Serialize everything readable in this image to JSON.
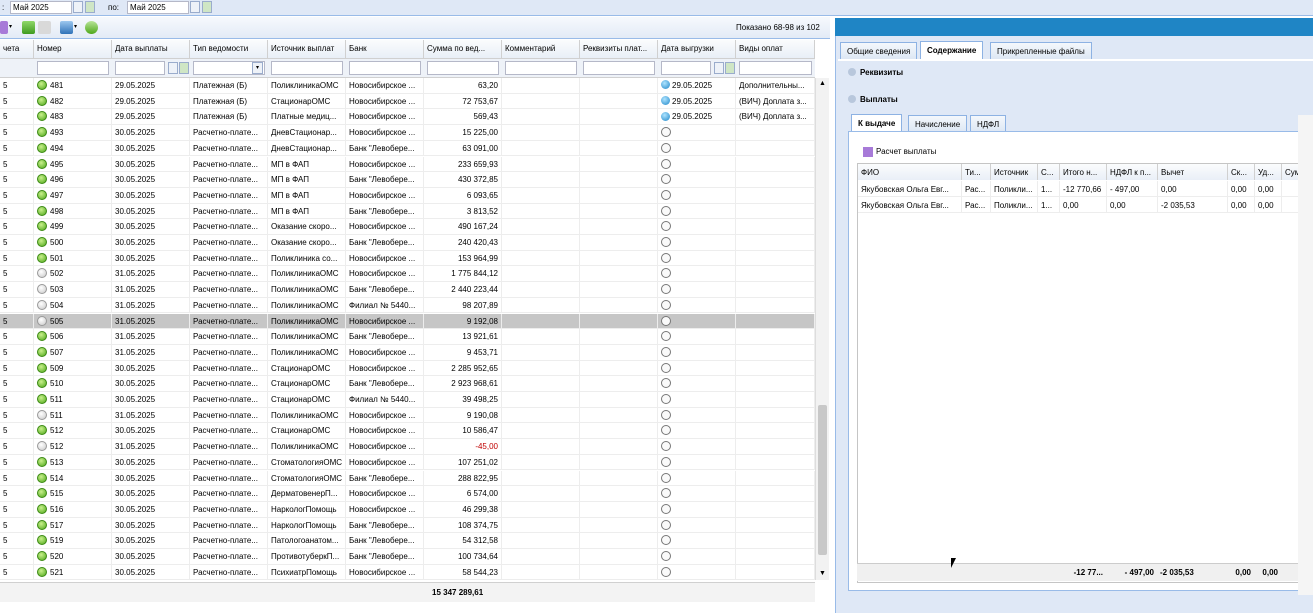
{
  "filter": {
    "from_prefix": ":",
    "from_value": "Май 2025",
    "to_label": "по:",
    "to_value": "Май 2025"
  },
  "grid": {
    "shown_label": "Показано 68-98 из 102",
    "columns": [
      "чета",
      "Номер",
      "Дата выплаты",
      "Тип ведомости",
      "Источник выплат",
      "Банк",
      "Сумма по вед...",
      "Комментарий",
      "Реквизиты плат...",
      "Дата выгрузки",
      "Виды оплат"
    ],
    "rows": [
      {
        "c0": "5",
        "num": "481",
        "st": "ok",
        "date": "29.05.2025",
        "type": "Платежная (Б)",
        "src": "ПоликлиникаОМС",
        "bank": "Новосибирское ...",
        "sum": "63,20",
        "exp": "29.05.2025",
        "kinds": "Дополнительны..."
      },
      {
        "c0": "5",
        "num": "482",
        "st": "ok",
        "date": "29.05.2025",
        "type": "Платежная (Б)",
        "src": "СтационарОМС",
        "bank": "Новосибирское ...",
        "sum": "72 753,67",
        "exp": "29.05.2025",
        "kinds": "(ВИЧ) Доплата з..."
      },
      {
        "c0": "5",
        "num": "483",
        "st": "ok",
        "date": "29.05.2025",
        "type": "Платежная (Б)",
        "src": "Платные медиц...",
        "bank": "Новосибирское ...",
        "sum": "569,43",
        "exp": "29.05.2025",
        "kinds": "(ВИЧ) Доплата з..."
      },
      {
        "c0": "5",
        "num": "493",
        "st": "ok",
        "date": "30.05.2025",
        "type": "Расчетно-плате...",
        "src": "ДневСтационар...",
        "bank": "Новосибирское ...",
        "sum": "15 225,00",
        "exp": "",
        "kinds": ""
      },
      {
        "c0": "5",
        "num": "494",
        "st": "ok",
        "date": "30.05.2025",
        "type": "Расчетно-плате...",
        "src": "ДневСтационар...",
        "bank": "Банк \"Левобере...",
        "sum": "63 091,00",
        "exp": "",
        "kinds": ""
      },
      {
        "c0": "5",
        "num": "495",
        "st": "ok",
        "date": "30.05.2025",
        "type": "Расчетно-плате...",
        "src": "МП в ФАП",
        "bank": "Новосибирское ...",
        "sum": "233 659,93",
        "exp": "",
        "kinds": ""
      },
      {
        "c0": "5",
        "num": "496",
        "st": "ok",
        "date": "30.05.2025",
        "type": "Расчетно-плате...",
        "src": "МП в ФАП",
        "bank": "Банк \"Левобере...",
        "sum": "430 372,85",
        "exp": "",
        "kinds": ""
      },
      {
        "c0": "5",
        "num": "497",
        "st": "ok",
        "date": "30.05.2025",
        "type": "Расчетно-плате...",
        "src": "МП в ФАП",
        "bank": "Новосибирское ...",
        "sum": "6 093,65",
        "exp": "",
        "kinds": ""
      },
      {
        "c0": "5",
        "num": "498",
        "st": "ok",
        "date": "30.05.2025",
        "type": "Расчетно-плате...",
        "src": "МП в ФАП",
        "bank": "Банк \"Левобере...",
        "sum": "3 813,52",
        "exp": "",
        "kinds": ""
      },
      {
        "c0": "5",
        "num": "499",
        "st": "ok",
        "date": "30.05.2025",
        "type": "Расчетно-плате...",
        "src": "Оказание скоро...",
        "bank": "Новосибирское ...",
        "sum": "490 167,24",
        "exp": "",
        "kinds": ""
      },
      {
        "c0": "5",
        "num": "500",
        "st": "ok",
        "date": "30.05.2025",
        "type": "Расчетно-плате...",
        "src": "Оказание скоро...",
        "bank": "Банк \"Левобере...",
        "sum": "240 420,43",
        "exp": "",
        "kinds": ""
      },
      {
        "c0": "5",
        "num": "501",
        "st": "ok",
        "date": "30.05.2025",
        "type": "Расчетно-плате...",
        "src": "Поликлиника со...",
        "bank": "Новосибирское ...",
        "sum": "153 964,99",
        "exp": "",
        "kinds": ""
      },
      {
        "c0": "5",
        "num": "502",
        "st": "grey",
        "date": "31.05.2025",
        "type": "Расчетно-плате...",
        "src": "ПоликлиникаОМС",
        "bank": "Новосибирское ...",
        "sum": "1 775 844,12",
        "exp": "",
        "kinds": ""
      },
      {
        "c0": "5",
        "num": "503",
        "st": "grey",
        "date": "31.05.2025",
        "type": "Расчетно-плате...",
        "src": "ПоликлиникаОМС",
        "bank": "Банк \"Левобере...",
        "sum": "2 440 223,44",
        "exp": "",
        "kinds": ""
      },
      {
        "c0": "5",
        "num": "504",
        "st": "grey",
        "date": "31.05.2025",
        "type": "Расчетно-плате...",
        "src": "ПоликлиникаОМС",
        "bank": "Филиал № 5440...",
        "sum": "98 207,89",
        "exp": "",
        "kinds": ""
      },
      {
        "c0": "5",
        "num": "505",
        "st": "grey",
        "date": "31.05.2025",
        "type": "Расчетно-плате...",
        "src": "ПоликлиникаОМС",
        "bank": "Новосибирское ...",
        "sum": "9 192,08",
        "exp": "",
        "kinds": "",
        "sel": true
      },
      {
        "c0": "5",
        "num": "506",
        "st": "ok",
        "date": "31.05.2025",
        "type": "Расчетно-плате...",
        "src": "ПоликлиникаОМС",
        "bank": "Банк \"Левобере...",
        "sum": "13 921,61",
        "exp": "",
        "kinds": ""
      },
      {
        "c0": "5",
        "num": "507",
        "st": "ok",
        "date": "31.05.2025",
        "type": "Расчетно-плате...",
        "src": "ПоликлиникаОМС",
        "bank": "Новосибирское ...",
        "sum": "9 453,71",
        "exp": "",
        "kinds": ""
      },
      {
        "c0": "5",
        "num": "509",
        "st": "ok",
        "date": "30.05.2025",
        "type": "Расчетно-плате...",
        "src": "СтационарОМС",
        "bank": "Новосибирское ...",
        "sum": "2 285 952,65",
        "exp": "",
        "kinds": ""
      },
      {
        "c0": "5",
        "num": "510",
        "st": "ok",
        "date": "30.05.2025",
        "type": "Расчетно-плате...",
        "src": "СтационарОМС",
        "bank": "Банк \"Левобере...",
        "sum": "2 923 968,61",
        "exp": "",
        "kinds": ""
      },
      {
        "c0": "5",
        "num": "511",
        "st": "ok",
        "date": "30.05.2025",
        "type": "Расчетно-плате...",
        "src": "СтационарОМС",
        "bank": "Филиал № 5440...",
        "sum": "39 498,25",
        "exp": "",
        "kinds": ""
      },
      {
        "c0": "5",
        "num": "511",
        "st": "grey",
        "date": "31.05.2025",
        "type": "Расчетно-плате...",
        "src": "ПоликлиникаОМС",
        "bank": "Новосибирское ...",
        "sum": "9 190,08",
        "exp": "",
        "kinds": ""
      },
      {
        "c0": "5",
        "num": "512",
        "st": "ok",
        "date": "30.05.2025",
        "type": "Расчетно-плате...",
        "src": "СтационарОМС",
        "bank": "Новосибирское ...",
        "sum": "10 586,47",
        "exp": "",
        "kinds": ""
      },
      {
        "c0": "5",
        "num": "512",
        "st": "grey",
        "date": "31.05.2025",
        "type": "Расчетно-плате...",
        "src": "ПоликлиникаОМС",
        "bank": "Новосибирское ...",
        "sum": "-45,00",
        "exp": "",
        "kinds": "",
        "neg": true
      },
      {
        "c0": "5",
        "num": "513",
        "st": "ok",
        "date": "30.05.2025",
        "type": "Расчетно-плате...",
        "src": "СтоматологияОМС",
        "bank": "Новосибирское ...",
        "sum": "107 251,02",
        "exp": "",
        "kinds": ""
      },
      {
        "c0": "5",
        "num": "514",
        "st": "ok",
        "date": "30.05.2025",
        "type": "Расчетно-плате...",
        "src": "СтоматологияОМС",
        "bank": "Банк \"Левобере...",
        "sum": "288 822,95",
        "exp": "",
        "kinds": ""
      },
      {
        "c0": "5",
        "num": "515",
        "st": "ok",
        "date": "30.05.2025",
        "type": "Расчетно-плате...",
        "src": "ДерматовенерП...",
        "bank": "Новосибирское ...",
        "sum": "6 574,00",
        "exp": "",
        "kinds": ""
      },
      {
        "c0": "5",
        "num": "516",
        "st": "ok",
        "date": "30.05.2025",
        "type": "Расчетно-плате...",
        "src": "НаркологПомощь",
        "bank": "Новосибирское ...",
        "sum": "46 299,38",
        "exp": "",
        "kinds": ""
      },
      {
        "c0": "5",
        "num": "517",
        "st": "ok",
        "date": "30.05.2025",
        "type": "Расчетно-плате...",
        "src": "НаркологПомощь",
        "bank": "Банк \"Левобере...",
        "sum": "108 374,75",
        "exp": "",
        "kinds": ""
      },
      {
        "c0": "5",
        "num": "519",
        "st": "ok",
        "date": "30.05.2025",
        "type": "Расчетно-плате...",
        "src": "Патологоанатом...",
        "bank": "Банк \"Левобере...",
        "sum": "54 312,58",
        "exp": "",
        "kinds": ""
      },
      {
        "c0": "5",
        "num": "520",
        "st": "ok",
        "date": "30.05.2025",
        "type": "Расчетно-плате...",
        "src": "ПротивотуберкП...",
        "bank": "Банк \"Левобере...",
        "sum": "100 734,64",
        "exp": "",
        "kinds": ""
      },
      {
        "c0": "5",
        "num": "521",
        "st": "ok",
        "date": "30.05.2025",
        "type": "Расчетно-плате...",
        "src": "ПсихиатрПомощь",
        "bank": "Новосибирское ...",
        "sum": "58 544,23",
        "exp": "",
        "kinds": ""
      }
    ],
    "total": "15 347 289,61"
  },
  "detail": {
    "tabs": [
      "Общие сведения",
      "Содержание",
      "Прикрепленные файлы"
    ],
    "sec_req": "Реквизиты",
    "sec_pay": "Выплаты",
    "subtabs": [
      "К выдаче",
      "Начисление",
      "НДФЛ"
    ],
    "calc_button": "Расчет выплаты",
    "columns": [
      "ФИО",
      "Ти...",
      "Источник",
      "С...",
      "Итого н...",
      "НДФЛ к п...",
      "Вычет",
      "Ск...",
      "Уд...",
      "Сум"
    ],
    "rows": [
      [
        "Якубовская Ольга Евг...",
        "Рас...",
        "Поликли...",
        "1...",
        "-12 770,66",
        "- 497,00",
        "0,00",
        "0,00",
        "0,00",
        ""
      ],
      [
        "Якубовская Ольга Евг...",
        "Рас...",
        "Поликли...",
        "1...",
        "0,00",
        "0,00",
        "-2 035,53",
        "0,00",
        "0,00",
        ""
      ]
    ],
    "totals": {
      "itogo": "-12 77...",
      "ndfl": "- 497,00",
      "vychet": "-2 035,53",
      "sk": "0,00",
      "ud": "0,00"
    }
  }
}
